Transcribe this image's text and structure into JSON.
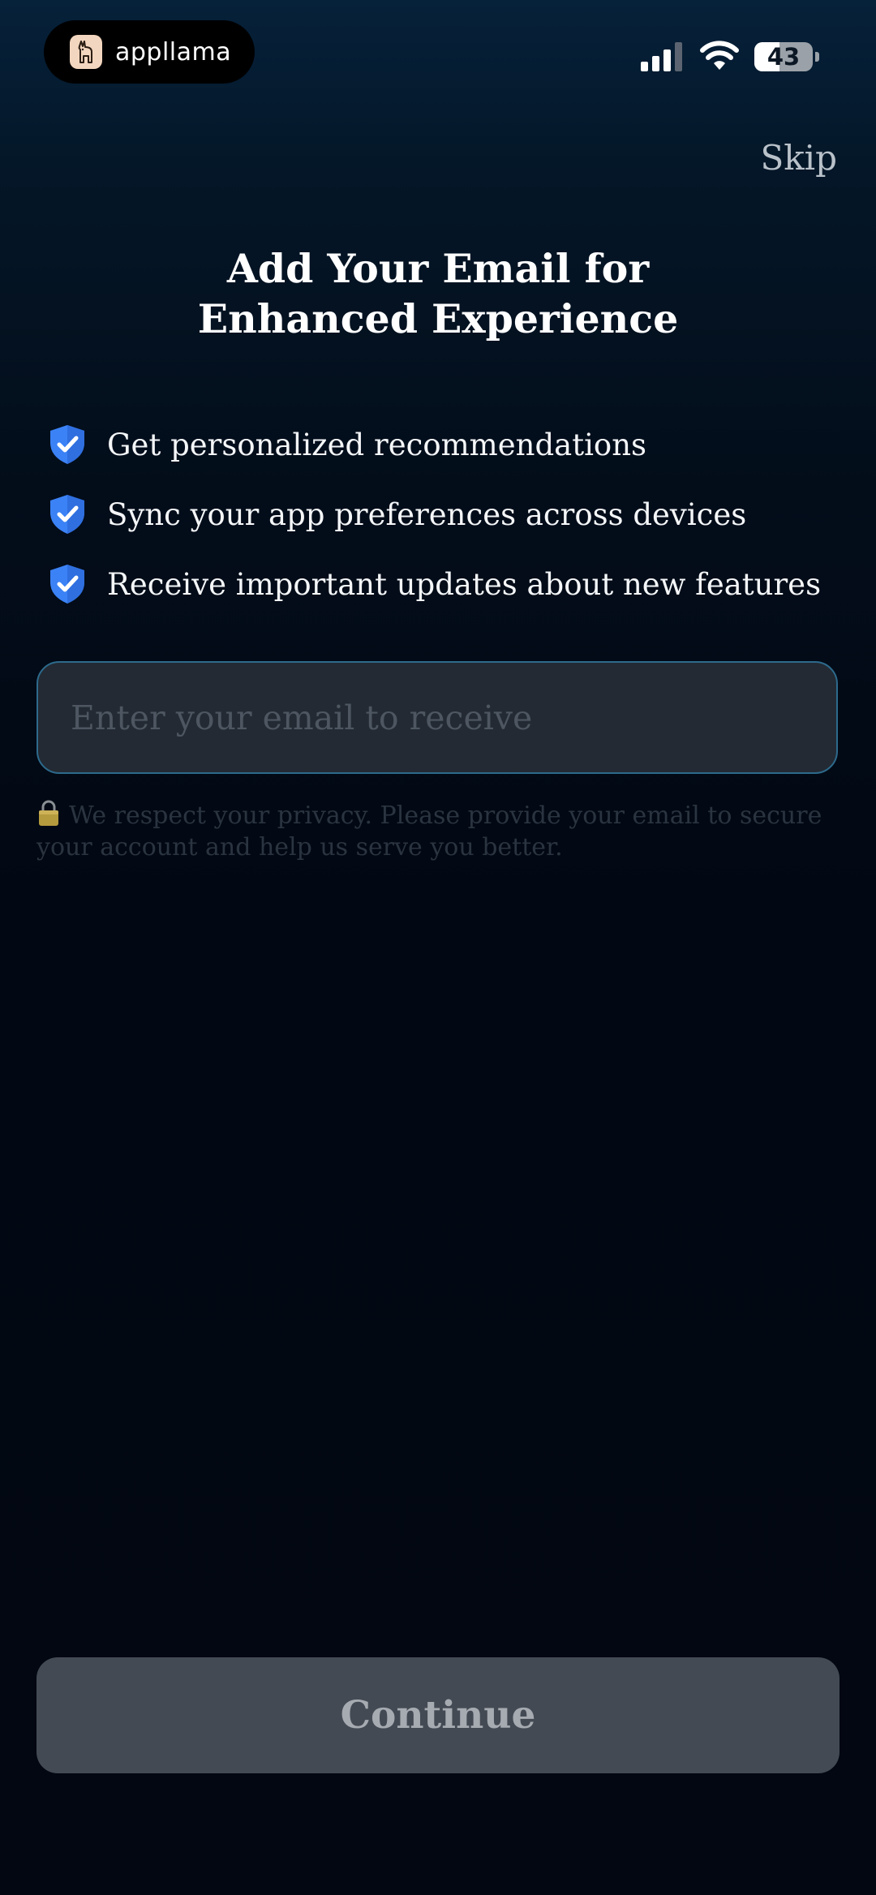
{
  "status_bar": {
    "app_name": "appllama",
    "battery_level": "43",
    "battery_percent": 43
  },
  "header": {
    "skip_label": "Skip"
  },
  "main": {
    "title_line1": "Add Your Email for",
    "title_line2": "Enhanced Experience",
    "features": [
      {
        "icon": "shield-check-icon",
        "text": "Get personalized recommendations"
      },
      {
        "icon": "shield-check-icon",
        "text": "Sync your app preferences across devices"
      },
      {
        "icon": "shield-check-icon",
        "text": "Receive important updates about new features"
      }
    ],
    "email": {
      "value": "",
      "placeholder": "Enter your email to receive"
    },
    "privacy_note": "We respect your privacy. Please provide your email to secure your account and help us serve you better."
  },
  "footer": {
    "continue_label": "Continue"
  },
  "colors": {
    "accent_shield": "#3b82f6",
    "input_border": "#2d6a8c",
    "button_bg": "#444a53"
  }
}
